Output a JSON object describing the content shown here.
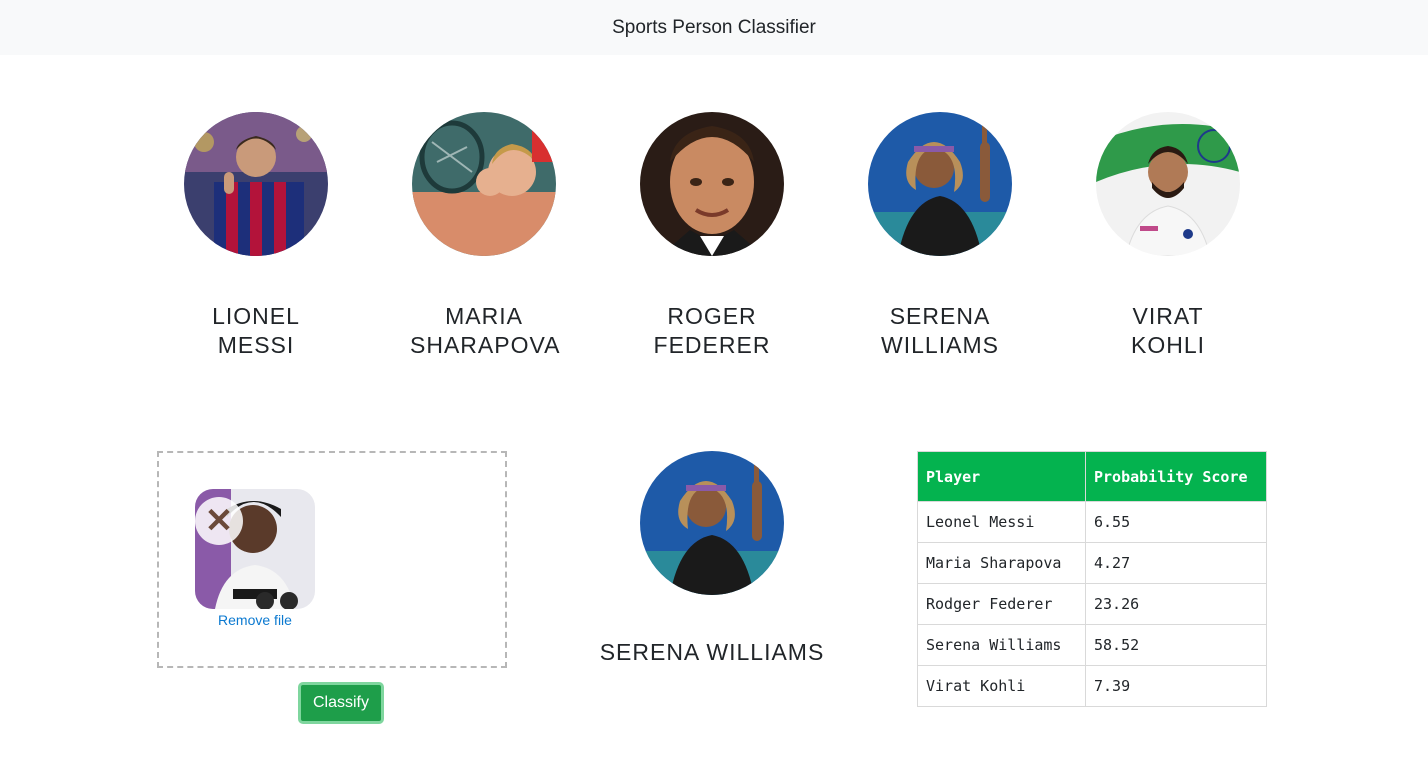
{
  "app": {
    "title": "Sports Person Classifier"
  },
  "players": [
    {
      "name": "LIONEL MESSI"
    },
    {
      "name": "MARIA SHARAPOVA"
    },
    {
      "name": "ROGER FEDERER"
    },
    {
      "name": "SERENA WILLIAMS"
    },
    {
      "name": "VIRAT KOHLI"
    }
  ],
  "upload": {
    "remove_label": "Remove file",
    "remove_icon": "close-icon"
  },
  "classify": {
    "label": "Classify"
  },
  "result": {
    "name": "SERENA WILLIAMS"
  },
  "scores": {
    "headers": [
      "Player",
      "Probability Score"
    ],
    "rows": [
      {
        "player": "Leonel Messi",
        "score": "6.55"
      },
      {
        "player": "Maria Sharapova",
        "score": "4.27"
      },
      {
        "player": "Rodger Federer",
        "score": "23.26"
      },
      {
        "player": "Serena Williams",
        "score": "58.52"
      },
      {
        "player": "Virat Kohli",
        "score": "7.39"
      }
    ]
  },
  "colors": {
    "accent": "#04b34f",
    "button": "#1e9e4a",
    "link": "#0b79d0",
    "navbar": "#f8f9fa"
  }
}
